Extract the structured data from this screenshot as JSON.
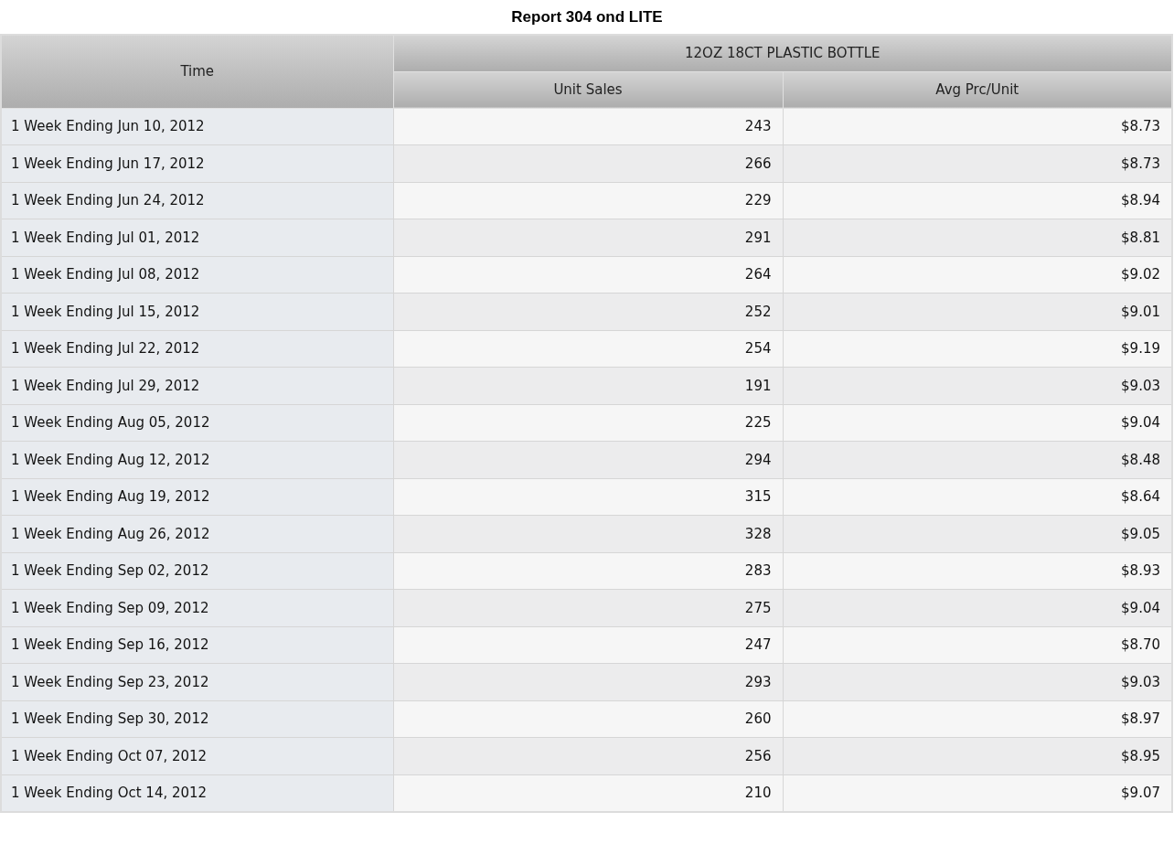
{
  "title": "Report 304 ond LITE",
  "table": {
    "row_header": "Time",
    "group": "12OZ 18CT PLASTIC BOTTLE",
    "columns": [
      "Unit Sales",
      "Avg Prc/Unit"
    ],
    "rows": [
      {
        "time": "1 Week Ending Jun 10, 2012",
        "values": [
          "243",
          "$8.73"
        ]
      },
      {
        "time": "1 Week Ending Jun 17, 2012",
        "values": [
          "266",
          "$8.73"
        ]
      },
      {
        "time": "1 Week Ending Jun 24, 2012",
        "values": [
          "229",
          "$8.94"
        ]
      },
      {
        "time": "1 Week Ending Jul 01, 2012",
        "values": [
          "291",
          "$8.81"
        ]
      },
      {
        "time": "1 Week Ending Jul 08, 2012",
        "values": [
          "264",
          "$9.02"
        ]
      },
      {
        "time": "1 Week Ending Jul 15, 2012",
        "values": [
          "252",
          "$9.01"
        ]
      },
      {
        "time": "1 Week Ending Jul 22, 2012",
        "values": [
          "254",
          "$9.19"
        ]
      },
      {
        "time": "1 Week Ending Jul 29, 2012",
        "values": [
          "191",
          "$9.03"
        ]
      },
      {
        "time": "1 Week Ending Aug 05, 2012",
        "values": [
          "225",
          "$9.04"
        ]
      },
      {
        "time": "1 Week Ending Aug 12, 2012",
        "values": [
          "294",
          "$8.48"
        ]
      },
      {
        "time": "1 Week Ending Aug 19, 2012",
        "values": [
          "315",
          "$8.64"
        ]
      },
      {
        "time": "1 Week Ending Aug 26, 2012",
        "values": [
          "328",
          "$9.05"
        ]
      },
      {
        "time": "1 Week Ending Sep 02, 2012",
        "values": [
          "283",
          "$8.93"
        ]
      },
      {
        "time": "1 Week Ending Sep 09, 2012",
        "values": [
          "275",
          "$9.04"
        ]
      },
      {
        "time": "1 Week Ending Sep 16, 2012",
        "values": [
          "247",
          "$8.70"
        ]
      },
      {
        "time": "1 Week Ending Sep 23, 2012",
        "values": [
          "293",
          "$9.03"
        ]
      },
      {
        "time": "1 Week Ending Sep 30, 2012",
        "values": [
          "260",
          "$8.97"
        ]
      },
      {
        "time": "1 Week Ending Oct 07, 2012",
        "values": [
          "256",
          "$8.95"
        ]
      },
      {
        "time": "1 Week Ending Oct 14, 2012",
        "values": [
          "210",
          "$9.07"
        ]
      }
    ]
  }
}
